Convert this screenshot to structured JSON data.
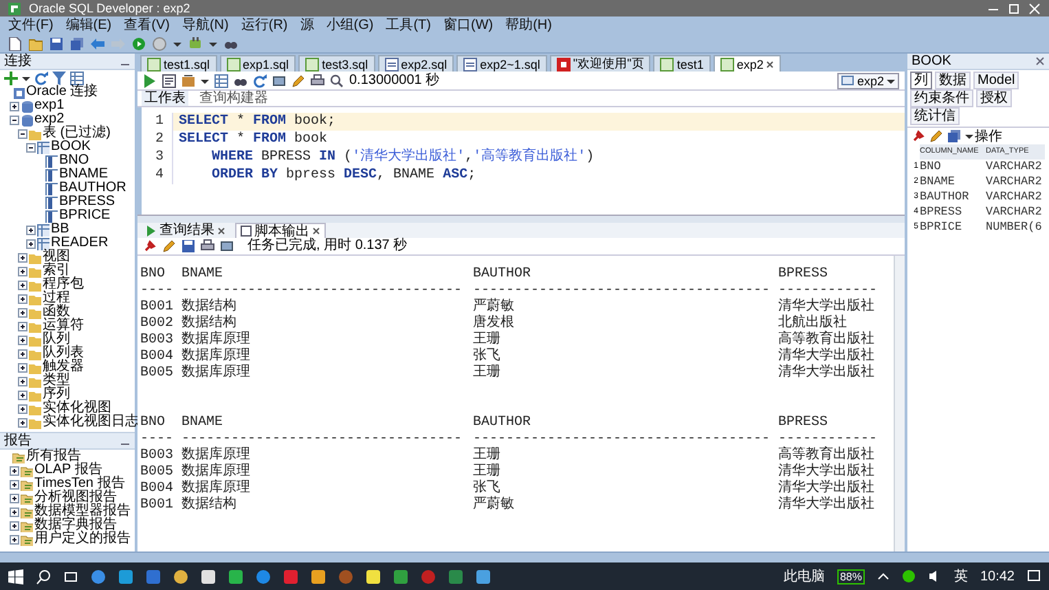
{
  "window": {
    "title": "Oracle SQL Developer : exp2"
  },
  "menu": [
    "文件(F)",
    "编辑(E)",
    "查看(V)",
    "导航(N)",
    "运行(R)",
    "源",
    "小组(G)",
    "工具(T)",
    "窗口(W)",
    "帮助(H)"
  ],
  "connections_panel": {
    "title": "连接",
    "tree": [
      {
        "label": "Oracle 连接",
        "kind": "root",
        "children": [
          {
            "label": "exp1",
            "kind": "connection",
            "expanded": false
          },
          {
            "label": "exp2",
            "kind": "connection",
            "expanded": true,
            "children": [
              {
                "label": "表 (已过滤)",
                "kind": "folder",
                "expanded": true,
                "children": [
                  {
                    "label": "BOOK",
                    "kind": "table",
                    "expanded": true,
                    "children": [
                      {
                        "label": "BNO",
                        "kind": "column"
                      },
                      {
                        "label": "BNAME",
                        "kind": "column"
                      },
                      {
                        "label": "BAUTHOR",
                        "kind": "column"
                      },
                      {
                        "label": "BPRESS",
                        "kind": "column"
                      },
                      {
                        "label": "BPRICE",
                        "kind": "column"
                      }
                    ]
                  },
                  {
                    "label": "BB",
                    "kind": "table",
                    "expanded": false
                  },
                  {
                    "label": "READER",
                    "kind": "table",
                    "expanded": false
                  }
                ]
              },
              {
                "label": "视图",
                "kind": "folder",
                "expanded": false
              },
              {
                "label": "索引",
                "kind": "folder",
                "expanded": false
              },
              {
                "label": "程序包",
                "kind": "folder",
                "expanded": false
              },
              {
                "label": "过程",
                "kind": "folder",
                "expanded": false
              },
              {
                "label": "函数",
                "kind": "folder",
                "expanded": false
              },
              {
                "label": "运算符",
                "kind": "folder",
                "expanded": false
              },
              {
                "label": "队列",
                "kind": "folder",
                "expanded": false
              },
              {
                "label": "队列表",
                "kind": "folder",
                "expanded": false
              },
              {
                "label": "触发器",
                "kind": "folder",
                "expanded": false
              },
              {
                "label": "类型",
                "kind": "folder",
                "expanded": false
              },
              {
                "label": "序列",
                "kind": "folder",
                "expanded": false
              },
              {
                "label": "实体化视图",
                "kind": "folder",
                "expanded": false
              },
              {
                "label": "实体化视图日志",
                "kind": "folder",
                "expanded": false
              }
            ]
          }
        ]
      }
    ]
  },
  "reports_panel": {
    "title": "报告",
    "tree": [
      {
        "label": "所有报告",
        "kind": "report",
        "children": [
          {
            "label": "OLAP 报告",
            "kind": "report",
            "expanded": false
          },
          {
            "label": "TimesTen 报告",
            "kind": "report",
            "expanded": false
          },
          {
            "label": "分析视图报告",
            "kind": "report",
            "expanded": false
          },
          {
            "label": "数据模型器报告",
            "kind": "report",
            "expanded": false
          },
          {
            "label": "数据字典报告",
            "kind": "report",
            "expanded": false
          },
          {
            "label": "用户定义的报告",
            "kind": "report",
            "expanded": false
          }
        ]
      }
    ]
  },
  "editor_tabs": [
    {
      "label": "test1.sql",
      "kind": "sql",
      "selected": false
    },
    {
      "label": "exp1.sql",
      "kind": "sql",
      "selected": false
    },
    {
      "label": "test3.sql",
      "kind": "sql",
      "selected": false
    },
    {
      "label": "exp2.sql",
      "kind": "file",
      "selected": false
    },
    {
      "label": "exp2~1.sql",
      "kind": "file",
      "selected": false
    },
    {
      "label": "\"欢迎使用\"页",
      "kind": "welcome",
      "selected": false
    },
    {
      "label": "test1",
      "kind": "sql",
      "selected": false
    },
    {
      "label": "exp2",
      "kind": "sql",
      "selected": true
    }
  ],
  "worksheet": {
    "timing": "0.13000001 秒",
    "connection": "exp2",
    "subtabs": [
      {
        "label": "工作表",
        "selected": true
      },
      {
        "label": "查询构建器",
        "selected": false
      }
    ],
    "lines": [
      {
        "number": "1",
        "current": true,
        "indent": false,
        "tokens": [
          {
            "kind": "keyword",
            "text": "SELECT"
          },
          {
            "kind": "plain",
            "text": " * "
          },
          {
            "kind": "keyword",
            "text": "FROM"
          },
          {
            "kind": "plain",
            "text": " book;"
          }
        ]
      },
      {
        "number": "2",
        "current": false,
        "indent": false,
        "tokens": [
          {
            "kind": "keyword",
            "text": "SELECT"
          },
          {
            "kind": "plain",
            "text": " * "
          },
          {
            "kind": "keyword",
            "text": "FROM"
          },
          {
            "kind": "plain",
            "text": " book"
          }
        ]
      },
      {
        "number": "3",
        "current": false,
        "indent": true,
        "tokens": [
          {
            "kind": "keyword",
            "text": "WHERE"
          },
          {
            "kind": "plain",
            "text": " BPRESS "
          },
          {
            "kind": "keyword",
            "text": "IN"
          },
          {
            "kind": "plain",
            "text": " ("
          },
          {
            "kind": "string",
            "text": "'清华大学出版社'"
          },
          {
            "kind": "plain",
            "text": ","
          },
          {
            "kind": "string",
            "text": "'高等教育出版社'"
          },
          {
            "kind": "plain",
            "text": ")"
          }
        ]
      },
      {
        "number": "4",
        "current": false,
        "indent": true,
        "tokens": [
          {
            "kind": "keyword",
            "text": "ORDER BY"
          },
          {
            "kind": "plain",
            "text": " bpress "
          },
          {
            "kind": "keyword",
            "text": "DESC"
          },
          {
            "kind": "plain",
            "text": ", BNAME "
          },
          {
            "kind": "keyword",
            "text": "ASC"
          },
          {
            "kind": "plain",
            "text": ";"
          }
        ]
      }
    ]
  },
  "results": {
    "tabs": [
      {
        "label": "查询结果",
        "selected": false
      },
      {
        "label": "脚本输出",
        "selected": true
      }
    ],
    "message": "任务已完成, 用时 0.137 秒",
    "blocks": [
      {
        "columns": [
          "BNO",
          "BNAME",
          "BAUTHOR",
          "BPRESS"
        ],
        "dashes": [
          "----",
          "----------------------------------",
          "------------------------------------",
          "------------"
        ],
        "rows": [
          [
            "B001",
            "数据结构",
            "严蔚敏",
            "清华大学出版社"
          ],
          [
            "B002",
            "数据结构",
            "唐发根",
            "北航出版社"
          ],
          [
            "B003",
            "数据库原理",
            "王珊",
            "高等教育出版社"
          ],
          [
            "B004",
            "数据库原理",
            "张飞",
            "清华大学出版社"
          ],
          [
            "B005",
            "数据库原理",
            "王珊",
            "清华大学出版社"
          ]
        ]
      },
      {
        "columns": [
          "BNO",
          "BNAME",
          "BAUTHOR",
          "BPRESS"
        ],
        "dashes": [
          "----",
          "----------------------------------",
          "------------------------------------",
          "------------"
        ],
        "rows": [
          [
            "B003",
            "数据库原理",
            "王珊",
            "高等教育出版社"
          ],
          [
            "B005",
            "数据库原理",
            "王珊",
            "清华大学出版社"
          ],
          [
            "B004",
            "数据库原理",
            "张飞",
            "清华大学出版社"
          ],
          [
            "B001",
            "数据结构",
            "严蔚敏",
            "清华大学出版社"
          ]
        ]
      }
    ]
  },
  "object_panel": {
    "title": "BOOK",
    "tabs": [
      {
        "label": "列",
        "selected": true
      },
      {
        "label": "数据",
        "selected": false
      },
      {
        "label": "Model",
        "selected": false
      },
      {
        "label": "约束条件",
        "selected": false
      },
      {
        "label": "授权",
        "selected": false
      },
      {
        "label": "统计信",
        "selected": false
      }
    ],
    "actions": "操作",
    "columns": [
      null,
      "COLUMN_NAME",
      "DATA_TYPE"
    ],
    "rows": [
      [
        "1",
        "BNO",
        "VARCHAR2"
      ],
      [
        "2",
        "BNAME",
        "VARCHAR2"
      ],
      [
        "3",
        "BAUTHOR",
        "VARCHAR2"
      ],
      [
        "4",
        "BPRESS",
        "VARCHAR2"
      ],
      [
        "5",
        "BPRICE",
        "NUMBER(6"
      ]
    ]
  },
  "taskbar": {
    "tray_label": "此电脑",
    "battery": "88%",
    "input_method": "英",
    "clock": "10:42"
  }
}
